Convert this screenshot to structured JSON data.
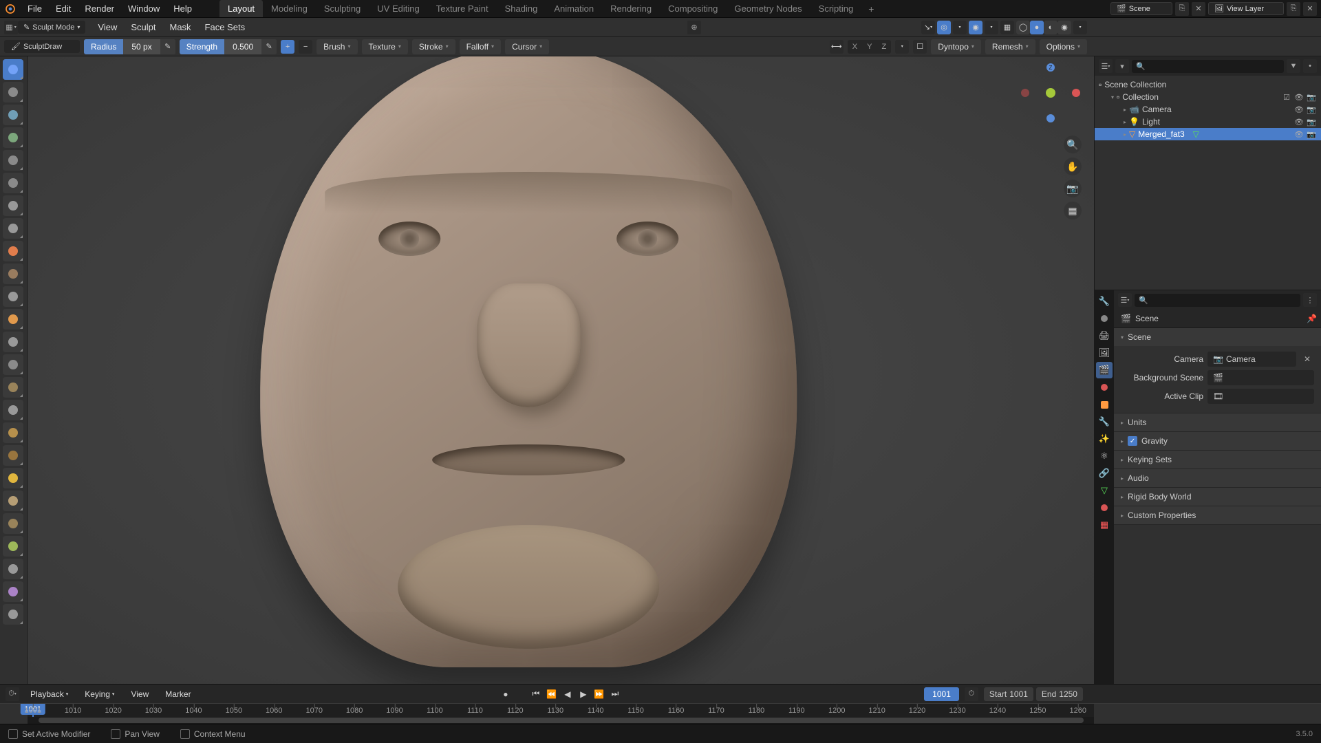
{
  "top_menu": {
    "file": "File",
    "edit": "Edit",
    "render": "Render",
    "window": "Window",
    "help": "Help"
  },
  "workspaces": [
    {
      "label": "Layout",
      "active": true
    },
    {
      "label": "Modeling"
    },
    {
      "label": "Sculpting"
    },
    {
      "label": "UV Editing"
    },
    {
      "label": "Texture Paint"
    },
    {
      "label": "Shading"
    },
    {
      "label": "Animation"
    },
    {
      "label": "Rendering"
    },
    {
      "label": "Compositing"
    },
    {
      "label": "Geometry Nodes"
    },
    {
      "label": "Scripting"
    }
  ],
  "scene_name": "Scene",
  "view_layer_name": "View Layer",
  "mode": "Sculpt Mode",
  "header_menus": {
    "view": "View",
    "sculpt": "Sculpt",
    "mask": "Mask",
    "face_sets": "Face Sets"
  },
  "brush": {
    "name": "SculptDraw",
    "radius_label": "Radius",
    "radius_value": "50 px",
    "strength_label": "Strength",
    "strength_value": "0.500"
  },
  "tool_dropdowns": {
    "brush": "Brush",
    "texture": "Texture",
    "stroke": "Stroke",
    "falloff": "Falloff",
    "cursor": "Cursor"
  },
  "tool_right": {
    "x": "X",
    "y": "Y",
    "z": "Z",
    "dyntopo": "Dyntopo",
    "remesh": "Remesh",
    "options": "Options"
  },
  "outliner": {
    "root": "Scene Collection",
    "collection": "Collection",
    "items": [
      {
        "label": "Camera",
        "icon": "camera"
      },
      {
        "label": "Light",
        "icon": "light"
      },
      {
        "label": "Merged_fat3",
        "icon": "mesh",
        "selected": true
      }
    ]
  },
  "properties": {
    "breadcrumb": "Scene",
    "scene_panel": "Scene",
    "camera_label": "Camera",
    "camera_value": "Camera",
    "background_label": "Background Scene",
    "activeclip_label": "Active Clip",
    "panels": [
      "Units",
      "Gravity",
      "Keying Sets",
      "Audio",
      "Rigid Body World",
      "Custom Properties"
    ]
  },
  "timeline": {
    "playback": "Playback",
    "keying": "Keying",
    "view": "View",
    "marker": "Marker",
    "current_frame": "1001",
    "start_label": "Start",
    "start_value": "1001",
    "end_label": "End",
    "end_value": "1250",
    "ticks": [
      "1001",
      "1010",
      "1020",
      "1030",
      "1040",
      "1050",
      "1060",
      "1070",
      "1080",
      "1090",
      "1100",
      "1110",
      "1120",
      "1130",
      "1140",
      "1150",
      "1160",
      "1170",
      "1180",
      "1190",
      "1200",
      "1210",
      "1220",
      "1230",
      "1240",
      "1250",
      "1260"
    ]
  },
  "status": {
    "set_active": "Set Active Modifier",
    "pan": "Pan View",
    "context": "Context Menu",
    "version": "3.5.0"
  }
}
